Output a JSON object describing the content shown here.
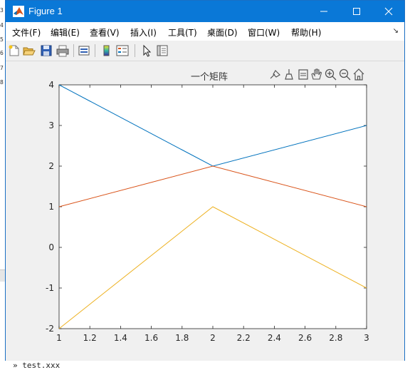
{
  "window": {
    "title": "Figure 1",
    "icons": [
      "matlab-logo-icon",
      "minimize-icon",
      "maximize-icon",
      "close-icon"
    ]
  },
  "menu": [
    {
      "label": "文件(F)",
      "underlined": "F"
    },
    {
      "label": "编辑(E)",
      "underlined": "E"
    },
    {
      "label": "查看(V)",
      "underlined": "V"
    },
    {
      "label": "插入(I)",
      "underlined": "I"
    },
    {
      "label": "工具(T)",
      "underlined": "T"
    },
    {
      "label": "桌面(D)",
      "underlined": "D"
    },
    {
      "label": "窗口(W)",
      "underlined": "W"
    },
    {
      "label": "帮助(H)",
      "underlined": "H"
    }
  ],
  "menu_pin": "↘",
  "toolbar_icons": [
    "new-figure-icon",
    "open-file-icon",
    "save-icon",
    "print-icon",
    "link-plot-icon",
    "colorbar-icon",
    "legend-icon",
    "edit-plot-arrow-icon",
    "property-inspector-icon"
  ],
  "axes_toolbar_icons": [
    "data-tip-icon",
    "brush-icon",
    "link-icon",
    "pan-icon",
    "zoom-in-icon",
    "zoom-out-icon",
    "home-icon"
  ],
  "background_text": {
    "side_numbers": [
      "3",
      "4",
      "5",
      "6",
      "7",
      "8"
    ],
    "command_line": "» test.xxx"
  },
  "colors": {
    "titlebar": "#0a78d7",
    "series1": "#0072bd",
    "series2": "#d95319",
    "series3": "#edb120"
  },
  "chart_data": {
    "type": "line",
    "title": "一个矩阵",
    "xlabel": "",
    "ylabel": "",
    "xlim": [
      1,
      3
    ],
    "ylim": [
      -2,
      4
    ],
    "xticks": [
      "1",
      "1.2",
      "1.4",
      "1.6",
      "1.8",
      "2",
      "2.2",
      "2.4",
      "2.6",
      "2.8",
      "3"
    ],
    "yticks": [
      "-2",
      "-1",
      "0",
      "1",
      "2",
      "3",
      "4"
    ],
    "grid": false,
    "x": [
      1,
      2,
      3
    ],
    "series": [
      {
        "values": [
          4,
          2,
          3
        ],
        "color": "#0072bd"
      },
      {
        "values": [
          1,
          2,
          1
        ],
        "color": "#d95319"
      },
      {
        "values": [
          -2,
          1,
          -1
        ],
        "color": "#edb120"
      }
    ]
  }
}
